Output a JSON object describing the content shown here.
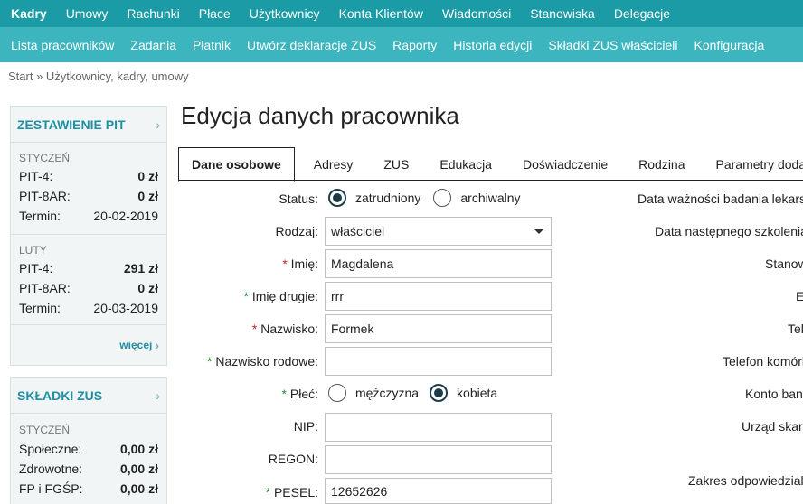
{
  "top_nav": [
    "Kadry",
    "Umowy",
    "Rachunki",
    "Płace",
    "Użytkownicy",
    "Konta Klientów",
    "Wiadomości",
    "Stanowiska",
    "Delegacje"
  ],
  "sub_nav": [
    "Lista pracowników",
    "Zadania",
    "Płatnik",
    "Utwórz deklaracje ZUS",
    "Raporty",
    "Historia edycji",
    "Składki ZUS właścicieli",
    "Konfiguracja"
  ],
  "breadcrumb": "Start » Użytkownicy, kadry, umowy",
  "pit": {
    "title": "ZESTAWIENIE PIT",
    "months": [
      {
        "name": "STYCZEŃ",
        "pit4_label": "PIT-4:",
        "pit4": "0 zł",
        "pit8ar_label": "PIT-8AR:",
        "pit8ar": "0 zł",
        "term_label": "Termin:",
        "term": "20-02-2019"
      },
      {
        "name": "LUTY",
        "pit4_label": "PIT-4:",
        "pit4": "291 zł",
        "pit8ar_label": "PIT-8AR:",
        "pit8ar": "0 zł",
        "term_label": "Termin:",
        "term": "20-03-2019"
      }
    ],
    "more": "więcej"
  },
  "zus": {
    "title": "SKŁADKI ZUS",
    "month": "STYCZEŃ",
    "rows": [
      {
        "label": "Społeczne:",
        "value": "0,00 zł"
      },
      {
        "label": "Zdrowotne:",
        "value": "0,00 zł"
      },
      {
        "label": "FP i FGŚP:",
        "value": "0,00 zł"
      }
    ]
  },
  "page_title": "Edycja danych pracownika",
  "tabs": [
    "Dane osobowe",
    "Adresy",
    "ZUS",
    "Edukacja",
    "Doświadczenie",
    "Rodzina",
    "Parametry dodatkowe"
  ],
  "form": {
    "status_label": "Status:",
    "status_options": [
      "zatrudniony",
      "archiwalny"
    ],
    "rodzaj_label": "Rodzaj:",
    "rodzaj_value": "właściciel",
    "imie_label": "Imię:",
    "imie_value": "Magdalena",
    "imie2_label": "Imię drugie:",
    "imie2_value": "rrr",
    "nazwisko_label": "Nazwisko:",
    "nazwisko_value": "Formek",
    "nazwisko_rod_label": "Nazwisko rodowe:",
    "nazwisko_rod_value": "",
    "plec_label": "Płeć:",
    "plec_options": [
      "mężczyzna",
      "kobieta"
    ],
    "nip_label": "NIP:",
    "nip_value": "",
    "regon_label": "REGON:",
    "regon_value": "",
    "pesel_label": "PESEL:",
    "pesel_value": "12652626"
  },
  "right_labels": [
    "Data ważności badania lekarskiego:",
    "Data następnego szkolenia BHP:",
    "Stanowisko:",
    "E-mail:",
    "Telefon:",
    "Telefon komórkowy:",
    "Konto bankowe:",
    "Urząd skarbowy:",
    "Zakres odpowiedzialności:"
  ],
  "colors": {
    "top_nav": "#1a9ba6",
    "sub_nav": "#3cb5be",
    "accent": "#1f8fa3",
    "radio": "#1d3c49"
  }
}
